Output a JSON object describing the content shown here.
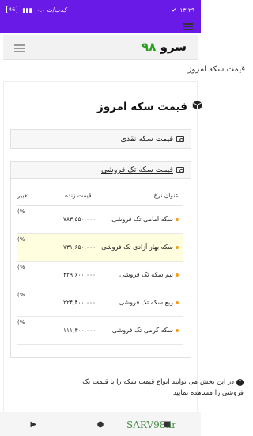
{
  "status": {
    "time": "۱۳:۲۹",
    "battery": "46",
    "speed": "۰.۰ ک.ب/ث"
  },
  "app": {
    "logo_text": "سرو",
    "logo_num": "۹۸",
    "subtitle": "قیمت سکه امروز"
  },
  "page": {
    "heading": "قیمت سکه امروز",
    "cash_title": "قیمت سکه نقدی",
    "single_title": "قیمت سکه تک فروشی"
  },
  "table": {
    "headers": [
      "عنوان نرخ",
      "قیمت زنده",
      "تغییر"
    ],
    "rows": [
      {
        "name": "سکه امامی تک فروشی",
        "price": "۷۸۳,۵۵۰,۰۰۰",
        "change": "(%"
      },
      {
        "name": "سکه بهار آزادی تک فروشی",
        "price": "۷۳۱,۶۵۰,۰۰۰",
        "change": "(%"
      },
      {
        "name": "نیم سکه تک فروشی",
        "price": "۴۲۹,۶۰۰,۰۰۰",
        "change": "(%"
      },
      {
        "name": "ربع سکه تک فروشی",
        "price": "۲۲۴,۴۰۰,۰۰۰",
        "change": "(%"
      },
      {
        "name": "سکه گرمی تک فروشی",
        "price": "۱۱۱,۳۰۰,۰۰۰",
        "change": "(%"
      }
    ]
  },
  "note": "در این بخش می توانید انواع قیمت سکه را با قیمت تک فروشی را مشاهده نمایید",
  "watermark": "SARV98.ir",
  "colors": {
    "brand": "#6a1ae6",
    "logo_green": "#2aa01e",
    "highlight": "#ffffe0"
  }
}
